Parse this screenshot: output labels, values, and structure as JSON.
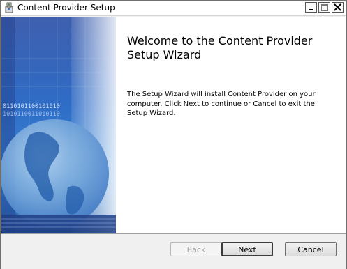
{
  "window": {
    "title": "Content Provider Setup"
  },
  "titlebar": {
    "minimize_icon": "minimize-icon",
    "maximize_icon": "maximize-icon",
    "close_icon": "close-icon"
  },
  "sidebar": {
    "binary_text_1": "0110101100101010",
    "binary_text_2": "1010110011010110"
  },
  "content": {
    "heading": "Welcome to the Content Provider Setup Wizard",
    "body": "The Setup Wizard will install Content Provider on your computer. Click Next to continue or Cancel to exit the Setup Wizard."
  },
  "buttons": {
    "back": "Back",
    "next": "Next",
    "cancel": "Cancel"
  }
}
